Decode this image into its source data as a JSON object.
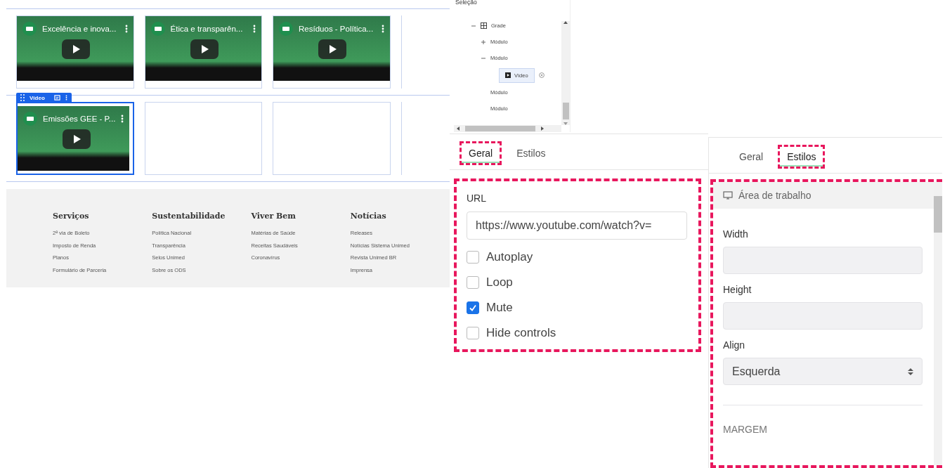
{
  "canvas": {
    "block_toolbar": {
      "label": "Vídeo"
    },
    "rows": [
      {
        "cells": [
          {
            "kind": "video",
            "title": "Excelência e inova...",
            "selected": false
          },
          {
            "kind": "video",
            "title": "Ética e transparên...",
            "selected": false
          },
          {
            "kind": "video",
            "title": "Resíduos - Política...",
            "selected": false
          }
        ]
      },
      {
        "cells": [
          {
            "kind": "video",
            "title": "Emissões GEE - P...",
            "selected": true
          },
          {
            "kind": "empty"
          },
          {
            "kind": "empty"
          }
        ]
      }
    ]
  },
  "footer": {
    "columns": [
      {
        "heading": "Serviços",
        "links": [
          "2ª via de Boleto",
          "Imposto de Renda",
          "Planos",
          "Formulário de Parceria"
        ]
      },
      {
        "heading": "Sustentabilidade",
        "links": [
          "Política Nacional",
          "Transparência",
          "Selos Unimed",
          "Sobre os ODS"
        ]
      },
      {
        "heading": "Viver Bem",
        "links": [
          "Matérias de Saúde",
          "Receitas Saudáveis",
          "Coronavírus"
        ]
      },
      {
        "heading": "Notícias",
        "links": [
          "Releases",
          "Notícias Sistema Unimed",
          "Revista Unimed BR",
          "Imprensa"
        ]
      }
    ]
  },
  "tree": {
    "title": "Seleção",
    "items": [
      {
        "label": "Grade",
        "expanded": true,
        "selected": false,
        "children": [
          {
            "label": "Módulo",
            "expanded": false,
            "selected": false
          },
          {
            "label": "Módulo",
            "expanded": true,
            "selected": false,
            "children": [
              {
                "label": "Vídeo",
                "selected": true
              }
            ]
          },
          {
            "label": "Módulo",
            "selected": false
          },
          {
            "label": "Módulo",
            "selected": false
          }
        ]
      }
    ]
  },
  "general_panel": {
    "tabs": [
      {
        "label": "Geral",
        "selected": true,
        "highlighted": true
      },
      {
        "label": "Estilos",
        "selected": false,
        "highlighted": false
      }
    ],
    "highlighted": true,
    "url_label": "URL",
    "url_value": "https://www.youtube.com/watch?v=",
    "options": [
      {
        "label": "Autoplay",
        "checked": false
      },
      {
        "label": "Loop",
        "checked": false
      },
      {
        "label": "Mute",
        "checked": true
      },
      {
        "label": "Hide controls",
        "checked": false
      }
    ]
  },
  "styles_panel": {
    "tabs": [
      {
        "label": "Geral",
        "selected": false,
        "highlighted": false
      },
      {
        "label": "Estilos",
        "selected": true,
        "highlighted": true
      }
    ],
    "highlighted": true,
    "section": "Área de trabalho",
    "width_label": "Width",
    "height_label": "Height",
    "align_label": "Align",
    "align_value": "Esquerda",
    "margin_heading": "MARGEM"
  }
}
